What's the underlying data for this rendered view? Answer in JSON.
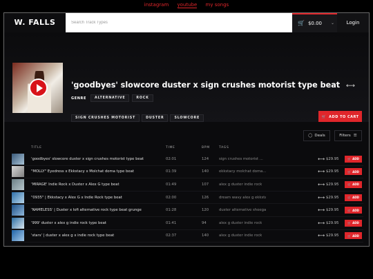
{
  "top_links": [
    {
      "label": "instagram",
      "active": false
    },
    {
      "label": "youtube",
      "active": true
    },
    {
      "label": "my songs",
      "active": false
    }
  ],
  "header": {
    "logo": "W. FALLS",
    "search_placeholder": "Search Track Types",
    "cart_total": "$0.00",
    "login": "Login"
  },
  "hero": {
    "title": "'goodbyes' slowcore duster x sign crushes motorist type beat",
    "genre_label": "GENRE",
    "genres": [
      "ALTERNATIVE",
      "ROCK"
    ],
    "tags": [
      "SIGN CRUSHES MOTORIST",
      "DUSTER",
      "SLOWCORE"
    ],
    "add_to_cart": "ADD TO CART"
  },
  "toolbar": {
    "deals": "Deals",
    "filters": "Filters"
  },
  "table": {
    "columns": [
      "TITLE",
      "TIME",
      "BPM",
      "TAGS"
    ],
    "add_label": "ADD",
    "rows": [
      {
        "title": "'goodbyes' slowcore duster x sign crushes motorist type beat",
        "time": "02:01",
        "bpm": "124",
        "tags": "sign crushes motorist ...",
        "price": "$29.95"
      },
      {
        "title": "\"MOLLY\" Eyedress x Ekkstacy x Molchat doma type beat",
        "time": "01:39",
        "bpm": "140",
        "tags": "ekkstacy  molchat doma...",
        "price": "$29.95"
      },
      {
        "title": "'MIRAGE' Indie Rock x Duster x Alex G type beat",
        "time": "01:49",
        "bpm": "107",
        "tags": "alex g  duster  indie rock",
        "price": "$29.95"
      },
      {
        "title": "\"0935\" | Ekkstacy x Alex G x Indie Rock type beat",
        "time": "02:00",
        "bpm": "126",
        "tags": "dream wavy  alex g  ekkstacy",
        "price": "$29.95"
      },
      {
        "title": "'NAMELESS' | Duster x lofi alternative rock type beat grunge",
        "time": "01:28",
        "bpm": "120",
        "tags": "duster  alternative  shoegaze",
        "price": "$29.95"
      },
      {
        "title": "'999' duster x alex g indie rock type beat",
        "time": "01:41",
        "bpm": "94",
        "tags": "alex g  duster  indie rock",
        "price": "$29.95"
      },
      {
        "title": "'stars' | duster x alex g x indie rock type beat",
        "time": "02:37",
        "bpm": "140",
        "tags": "alex g  duster  indie rock",
        "price": "$29.95"
      }
    ]
  },
  "colors": {
    "accent": "#e0262b",
    "background": "#0c0c0e"
  }
}
